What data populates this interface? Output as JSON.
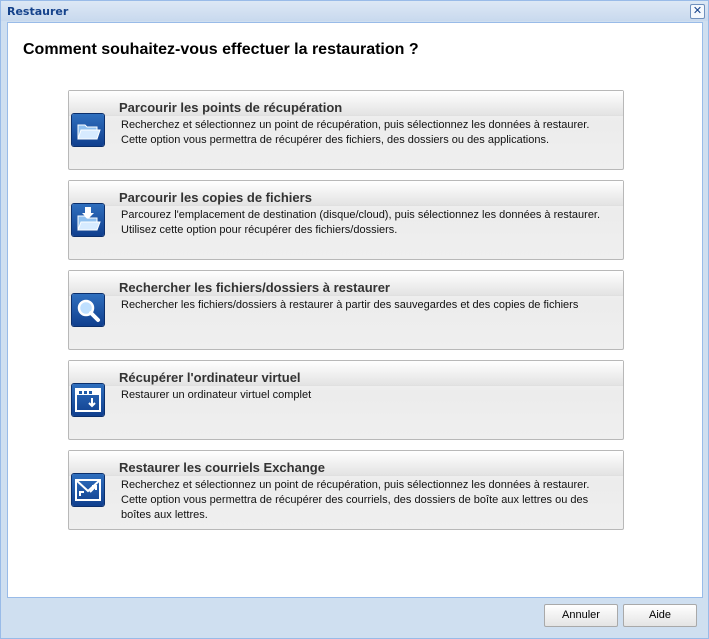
{
  "window": {
    "title": "Restaurer",
    "close_glyph": "✕"
  },
  "question": "Comment souhaitez-vous effectuer la restauration ?",
  "options": [
    {
      "title": "Parcourir les points de récupération",
      "description": "Recherchez et sélectionnez un point de récupération, puis sélectionnez les données à restaurer. Cette option vous permettra de récupérer des fichiers, des dossiers ou des applications.",
      "icon": "folder-open-icon"
    },
    {
      "title": "Parcourir les copies de fichiers",
      "description": "Parcourez l'emplacement de destination (disque/cloud), puis sélectionnez les données à restaurer. Utilisez cette option pour récupérer des fichiers/dossiers.",
      "icon": "folder-download-icon"
    },
    {
      "title": "Rechercher les fichiers/dossiers à restaurer",
      "description": "Rechercher les fichiers/dossiers à restaurer à partir des sauvegardes et des copies de fichiers",
      "icon": "magnifier-icon"
    },
    {
      "title": "Récupérer l'ordinateur virtuel",
      "description": "Restaurer un ordinateur virtuel complet",
      "icon": "virtual-machine-icon"
    },
    {
      "title": "Restaurer les courriels Exchange",
      "description": "Recherchez et sélectionnez un point de récupération, puis sélectionnez les données à restaurer. Cette option vous permettra de récupérer des courriels, des dossiers de boîte aux lettres ou des boîtes aux lettres.",
      "icon": "exchange-mail-icon"
    }
  ],
  "footer": {
    "cancel_label": "Annuler",
    "help_label": "Aide"
  },
  "colors": {
    "title_text": "#15428b",
    "frame": "#cfdff0",
    "icon_blue": "#1d5aa8"
  }
}
